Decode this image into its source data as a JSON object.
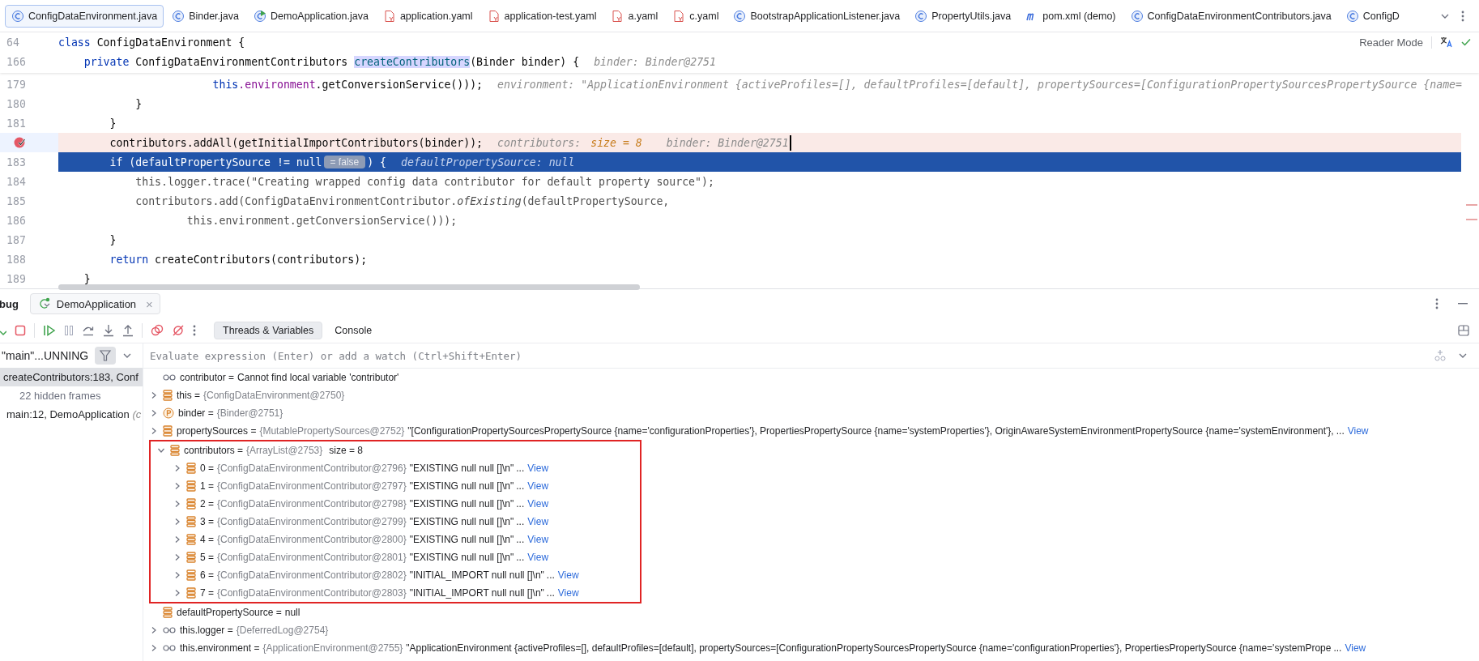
{
  "editor_tabs": [
    {
      "label": "ConfigDataEnvironment.java",
      "kind": "class",
      "selected": true
    },
    {
      "label": "Binder.java",
      "kind": "class",
      "selected": false
    },
    {
      "label": "DemoApplication.java",
      "kind": "app",
      "selected": false
    },
    {
      "label": "application.yaml",
      "kind": "yaml",
      "selected": false
    },
    {
      "label": "application-test.yaml",
      "kind": "yaml",
      "selected": false
    },
    {
      "label": "a.yaml",
      "kind": "yaml",
      "selected": false
    },
    {
      "label": "c.yaml",
      "kind": "yaml",
      "selected": false
    },
    {
      "label": "BootstrapApplicationListener.java",
      "kind": "class",
      "selected": false
    },
    {
      "label": "PropertyUtils.java",
      "kind": "class",
      "selected": false
    },
    {
      "label": "pom.xml (demo)",
      "kind": "maven",
      "selected": false
    },
    {
      "label": "ConfigDataEnvironmentContributors.java",
      "kind": "class",
      "selected": false
    },
    {
      "label": "ConfigD",
      "kind": "class",
      "selected": false
    }
  ],
  "editor": {
    "reader_mode": "Reader Mode",
    "sticky_lines": [
      {
        "number": "64",
        "segments": [
          {
            "kind": "kw",
            "text": "class "
          },
          {
            "kind": "plain",
            "text": "ConfigDataEnvironment {"
          }
        ]
      },
      {
        "number": "166",
        "segments": [
          {
            "kind": "kw",
            "text": "    private "
          },
          {
            "kind": "plain",
            "text": "ConfigDataEnvironmentContributors "
          },
          {
            "kind": "match",
            "text": "createContributors"
          },
          {
            "kind": "plain",
            "text": "(Binder binder) {"
          },
          {
            "kind": "hint",
            "text": "binder: Binder@2751"
          }
        ]
      }
    ],
    "lines": [
      {
        "number": "179",
        "breakpoint": false,
        "selected": false,
        "segments": [
          {
            "kind": "kw",
            "text": "                        this"
          },
          {
            "kind": "field",
            "text": ".environment"
          },
          {
            "kind": "plain",
            "text": ".getConversionService()));"
          },
          {
            "kind": "hint",
            "text": "environment: \"ApplicationEnvironment {activeProfiles=[], defaultProfiles=[default], propertySources=[ConfigurationPropertySourcesPropertySource {name="
          }
        ]
      },
      {
        "number": "180",
        "breakpoint": false,
        "selected": false,
        "segments": [
          {
            "kind": "plain",
            "text": "            }"
          }
        ]
      },
      {
        "number": "181",
        "breakpoint": false,
        "selected": false,
        "segments": [
          {
            "kind": "plain",
            "text": "        }"
          }
        ]
      },
      {
        "breakpoint": true,
        "selected": false,
        "segments": [
          {
            "kind": "plain",
            "text": "        contributors.addAll(getInitialImportContributors(binder));"
          },
          {
            "kind": "hint",
            "text": "contributors:"
          },
          {
            "kind": "hint-value",
            "text": "size = 8"
          },
          {
            "kind": "hint",
            "text": "binder: Binder@2751"
          }
        ]
      },
      {
        "number": "183",
        "breakpoint": false,
        "selected": true,
        "segments": [
          {
            "kind": "kw",
            "text": "        if "
          },
          {
            "kind": "plain",
            "text": "(defaultPropertySource != null"
          },
          {
            "kind": "badge",
            "text": "= false"
          },
          {
            "kind": "plain",
            "text": ") {"
          },
          {
            "kind": "hint",
            "text": "defaultPropertySource: null"
          }
        ]
      },
      {
        "number": "184",
        "breakpoint": false,
        "selected": false,
        "segments": [
          {
            "kind": "dim",
            "text": "            this.logger.trace(\"Creating wrapped config data contributor for default property source\");"
          }
        ]
      },
      {
        "number": "185",
        "breakpoint": false,
        "selected": false,
        "segments": [
          {
            "kind": "dim",
            "text": "            contributors.add(ConfigDataEnvironmentContributor."
          },
          {
            "kind": "dim-italic",
            "text": "ofExisting"
          },
          {
            "kind": "dim",
            "text": "(defaultPropertySource,"
          }
        ]
      },
      {
        "number": "186",
        "breakpoint": false,
        "selected": false,
        "segments": [
          {
            "kind": "dim",
            "text": "                    this.environment.getConversionService()));"
          }
        ]
      },
      {
        "number": "187",
        "breakpoint": false,
        "selected": false,
        "segments": [
          {
            "kind": "plain",
            "text": "        }"
          }
        ]
      },
      {
        "number": "188",
        "breakpoint": false,
        "selected": false,
        "segments": [
          {
            "kind": "kw",
            "text": "        return "
          },
          {
            "kind": "plain",
            "text": "createContributors(contributors);"
          }
        ]
      },
      {
        "number": "189",
        "breakpoint": false,
        "selected": false,
        "segments": [
          {
            "kind": "plain",
            "text": "    }"
          }
        ]
      }
    ]
  },
  "debug": {
    "title": "bug",
    "session_tab": {
      "label": "DemoApplication",
      "close": "×"
    },
    "view_tabs": [
      {
        "label": "Threads & Variables",
        "selected": true
      },
      {
        "label": "Console",
        "selected": false
      }
    ],
    "thread": "\"main\"...UNNING",
    "frames": [
      {
        "kind": "frame",
        "label": "createContributors:183, Conf",
        "selected": true
      },
      {
        "kind": "hidden",
        "label": "22 hidden frames",
        "selected": false
      },
      {
        "kind": "frame",
        "label": "main:12, DemoApplication",
        "location": "(c",
        "selected": false
      }
    ],
    "evaluate": {
      "placeholder": "Evaluate expression (Enter) or add a watch (Ctrl+Shift+Enter)"
    },
    "variables": [
      {
        "kind": "watch",
        "name": "contributor =",
        "value": "Cannot find local variable 'contributor'"
      },
      {
        "kind": "field",
        "name": "this =",
        "type": "{ConfigDataEnvironment@2750}",
        "expanded": false
      },
      {
        "kind": "param",
        "name": "binder =",
        "type": "{Binder@2751}",
        "expanded": false
      },
      {
        "kind": "field",
        "name": "propertySources =",
        "type": "{MutablePropertySources@2752}",
        "value": "\"[ConfigurationPropertySourcesPropertySource {name='configurationProperties'}, PropertiesPropertySource {name='systemProperties'}, OriginAwareSystemEnvironmentPropertySource {name='systemEnvironment'},",
        "more": "...",
        "link": "View",
        "expanded": false
      },
      {
        "kind": "field",
        "name": "contributors =",
        "type": "{ArrayList@2753}",
        "extra": "size = 8",
        "expanded": true,
        "highlighted": true,
        "children": [
          {
            "kind": "field",
            "name": "0 =",
            "type": "{ConfigDataEnvironmentContributor@2796}",
            "value": "\"EXISTING null null []\\n\"",
            "more": "...",
            "link": "View",
            "expanded": false
          },
          {
            "kind": "field",
            "name": "1 =",
            "type": "{ConfigDataEnvironmentContributor@2797}",
            "value": "\"EXISTING null null []\\n\"",
            "more": "...",
            "link": "View",
            "expanded": false
          },
          {
            "kind": "field",
            "name": "2 =",
            "type": "{ConfigDataEnvironmentContributor@2798}",
            "value": "\"EXISTING null null []\\n\"",
            "more": "...",
            "link": "View",
            "expanded": false
          },
          {
            "kind": "field",
            "name": "3 =",
            "type": "{ConfigDataEnvironmentContributor@2799}",
            "value": "\"EXISTING null null []\\n\"",
            "more": "...",
            "link": "View",
            "expanded": false
          },
          {
            "kind": "field",
            "name": "4 =",
            "type": "{ConfigDataEnvironmentContributor@2800}",
            "value": "\"EXISTING null null []\\n\"",
            "more": "...",
            "link": "View",
            "expanded": false
          },
          {
            "kind": "field",
            "name": "5 =",
            "type": "{ConfigDataEnvironmentContributor@2801}",
            "value": "\"EXISTING null null []\\n\"",
            "more": "...",
            "link": "View",
            "expanded": false
          },
          {
            "kind": "field",
            "name": "6 =",
            "type": "{ConfigDataEnvironmentContributor@2802}",
            "value": "\"INITIAL_IMPORT null null []\\n\"",
            "more": "...",
            "link": "View",
            "expanded": false
          },
          {
            "kind": "field",
            "name": "7 =",
            "type": "{ConfigDataEnvironmentContributor@2803}",
            "value": "\"INITIAL_IMPORT null null []\\n\"",
            "more": "...",
            "link": "View",
            "expanded": false
          }
        ]
      },
      {
        "kind": "field",
        "name": "defaultPropertySource =",
        "value": "null"
      },
      {
        "kind": "watch",
        "name": "this.logger =",
        "type": "{DeferredLog@2754}",
        "expanded": false
      },
      {
        "kind": "watch",
        "name": "this.environment =",
        "type": "{ApplicationEnvironment@2755}",
        "value": "\"ApplicationEnvironment {activeProfiles=[], defaultProfiles=[default], propertySources=[ConfigurationPropertySourcesPropertySource {name='configurationProperties'}, PropertiesPropertySource {name='systemPrope",
        "more": "...",
        "link": "View",
        "expanded": false
      }
    ]
  }
}
